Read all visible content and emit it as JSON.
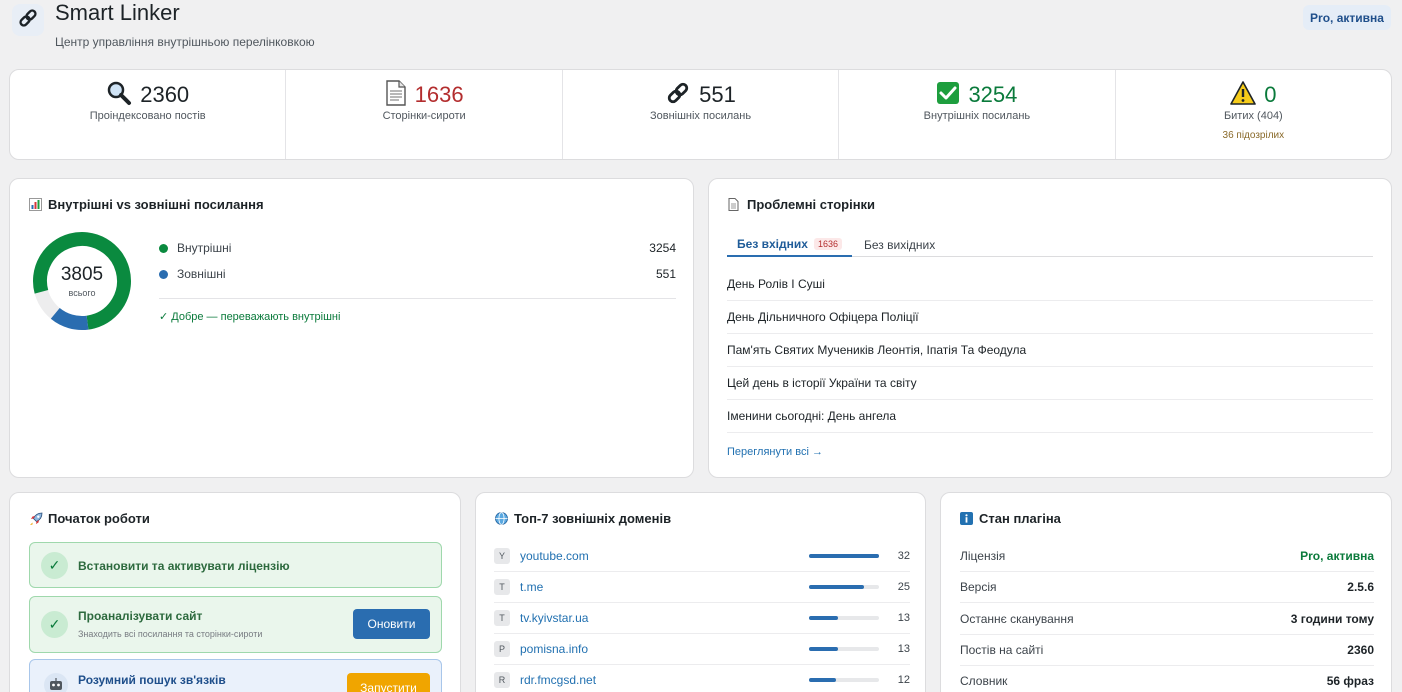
{
  "app": {
    "title": "Smart Linker",
    "subtitle": "Центр управління внутрішньою перелінковкою",
    "status_badge": "Pro, активна"
  },
  "stats": [
    {
      "icon": "magnifier-icon",
      "value": "2360",
      "label": "Проіндексовано постів",
      "color": "#1d2327"
    },
    {
      "icon": "document-icon",
      "value": "1636",
      "label": "Сторінки-сироти",
      "color": "#b32d2e"
    },
    {
      "icon": "link-icon",
      "value": "551",
      "label": "Зовнішніх посилань",
      "color": "#1d2327"
    },
    {
      "icon": "checkmark-icon",
      "value": "3254",
      "label": "Внутрішніх посилань",
      "color": "#0a7a3b"
    },
    {
      "icon": "warning-icon",
      "value": "0",
      "label": "Битих (404)",
      "sub": "36 підозрілих",
      "color": "#0a7a3b"
    }
  ],
  "links_chart": {
    "title": "Внутрішні vs зовнішні посилання",
    "total": "3805",
    "total_label": "всього",
    "legend": [
      {
        "name": "Внутрішні",
        "value": "3254",
        "color": "#0a8a3f"
      },
      {
        "name": "Зовнішні",
        "value": "551",
        "color": "#2a6db0"
      }
    ],
    "note": "✓ Добре — переважають внутрішні"
  },
  "chart_data": {
    "type": "pie",
    "title": "Внутрішні vs зовнішні посилання",
    "categories": [
      "Внутрішні",
      "Зовнішні"
    ],
    "values": [
      3254,
      551
    ]
  },
  "problems": {
    "title": "Проблемні сторінки",
    "tabs": [
      {
        "label": "Без вхідних",
        "count": "1636"
      },
      {
        "label": "Без вихідних"
      }
    ],
    "items": [
      "День Ролів І Суші",
      "День Дільничного Офіцера Поліції",
      "Пам'ять Святих Мучеників Леонтія, Іпатія Та Феодула",
      "Цей день в історії України та світу",
      "Іменини сьогодні: День ангела"
    ],
    "view_all": "Переглянути всі →"
  },
  "getting_started": {
    "title": "Початок роботи",
    "steps": [
      {
        "title": "Встановити та активувати ліцензію"
      },
      {
        "title": "Проаналізувати сайт",
        "desc": "Знаходить всі посилання та сторінки-сироти",
        "button": "Оновити"
      },
      {
        "title": "Розумний пошук зв'язків",
        "button": "Запустити"
      }
    ]
  },
  "domains": {
    "title": "Топ-7 зовнішніх доменів",
    "items": [
      {
        "letter": "Y",
        "name": "youtube.com",
        "count": "32",
        "share": 1.0
      },
      {
        "letter": "T",
        "name": "t.me",
        "count": "25",
        "share": 0.78
      },
      {
        "letter": "T",
        "name": "tv.kyivstar.ua",
        "count": "13",
        "share": 0.41
      },
      {
        "letter": "P",
        "name": "pomisna.info",
        "count": "13",
        "share": 0.41
      },
      {
        "letter": "R",
        "name": "rdr.fmcgsd.net",
        "count": "12",
        "share": 0.38
      }
    ]
  },
  "plugin_status": {
    "title": "Стан плагіна",
    "rows": [
      {
        "key": "Ліцензія",
        "value": "Pro, активна"
      },
      {
        "key": "Версія",
        "value": "2.5.6"
      },
      {
        "key": "Останнє сканування",
        "value": "3 години тому"
      },
      {
        "key": "Постів на сайті",
        "value": "2360"
      },
      {
        "key": "Словник",
        "value": "56 фраз"
      }
    ]
  }
}
